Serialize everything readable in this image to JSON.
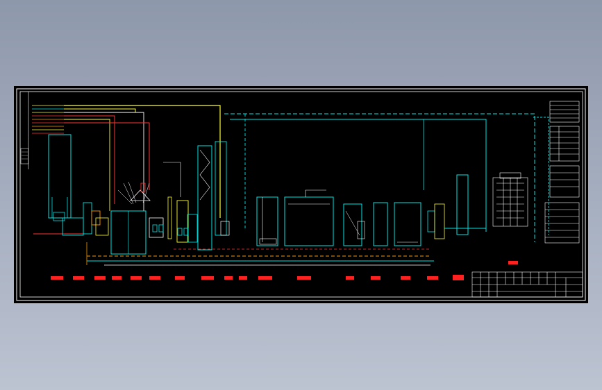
{
  "title_block": {
    "drawing_title": "",
    "project_name": ""
  },
  "legend": {
    "entries": []
  },
  "equipment_labels": [],
  "colors": {
    "background": "#000000",
    "frame": "#ffffff",
    "process_water": "#00e5e5",
    "chemical_feed": "#ffff33",
    "sludge": "#ff3333",
    "air": "#ff9900",
    "equipment": "#00ffff",
    "labels": "#ff2020",
    "hatch": "#dddddd"
  },
  "icons": [
    "tank-icon",
    "pump-icon",
    "valve-icon",
    "blower-icon",
    "filter-icon"
  ]
}
